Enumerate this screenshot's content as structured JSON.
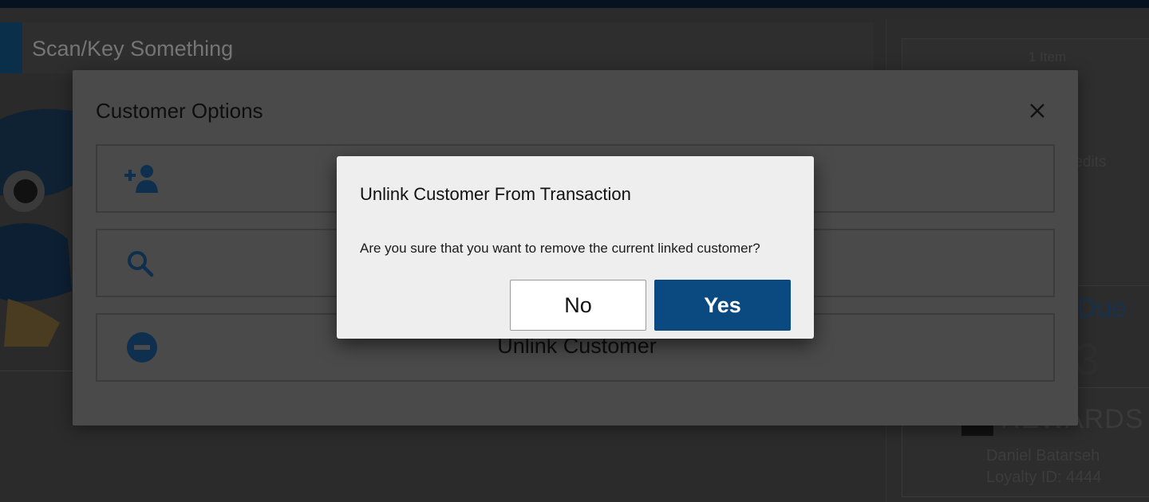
{
  "scan": {
    "placeholder": "Scan/Key Something"
  },
  "cart": {
    "item_count": "1 Item",
    "credits_label": "redits"
  },
  "due": {
    "label": "Due",
    "value": "3"
  },
  "rewards": {
    "label": "REWARDS",
    "customer_name": "Daniel Batarseh",
    "loyalty_id": "Loyalty ID: 4444"
  },
  "customer_options": {
    "title": "Customer Options",
    "rows": [
      {
        "icon": "add-person-icon",
        "label": ""
      },
      {
        "icon": "search-icon",
        "label": ""
      },
      {
        "icon": "minus-circle-icon",
        "label": "Unlink Customer"
      }
    ]
  },
  "confirm": {
    "title": "Unlink Customer From Transaction",
    "message": "Are you sure that you want to remove the current linked customer?",
    "no_label": "No",
    "yes_label": "Yes"
  },
  "colors": {
    "primary": "#0b4a80",
    "icon_dim": "#0e2f4e",
    "dialog_bg": "#eeeeee"
  }
}
